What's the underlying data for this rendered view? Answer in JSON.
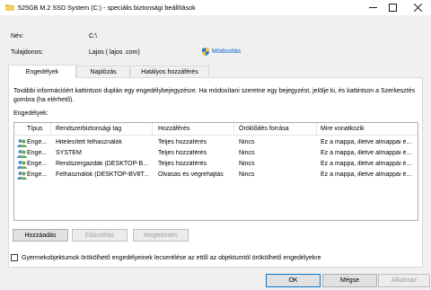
{
  "window": {
    "title": "525GB M.2 SSD System (C:) - speciális biztonsági beállítások"
  },
  "fields": {
    "name_label": "Név:",
    "name_value": "C:\\",
    "owner_label": "Tulajdonos:",
    "owner_value": "Lajos (     lajos              .com)",
    "modify_link": "Módosítás"
  },
  "tabs": [
    {
      "label": "Engedélyek",
      "active": true
    },
    {
      "label": "Naplózás",
      "active": false
    },
    {
      "label": "Hatályos hozzáférés",
      "active": false
    }
  ],
  "info_text": "További információért kattintson duplán egy engedélybejegyzésre. Ha módosítani szeretne egy bejegyzést, jelölje ki, és kattintson a Szerkesztés gombra (ha elérhető).",
  "permissions_label": "Engedélyek:",
  "table": {
    "columns": [
      "Típus",
      "Rendszerbiztonsági tag",
      "Hozzáférés",
      "Öröklődés forrása",
      "Mire vonatkozik"
    ],
    "rows": [
      [
        "Enge...",
        "Hitelesített felhasználók",
        "Teljes hozzáférés",
        "Nincs",
        "Ez a mappa, illetve almappái é..."
      ],
      [
        "Enge...",
        "SYSTEM",
        "Teljes hozzáférés",
        "Nincs",
        "Ez a mappa, illetve almappái é..."
      ],
      [
        "Enge...",
        "Rendszergazdák (DESKTOP-B...",
        "Teljes hozzáférés",
        "Nincs",
        "Ez a mappa, illetve almappái é..."
      ],
      [
        "Enge...",
        "Felhasználók (DESKTOP-BV8T...",
        "Olvasás és végrehajtás",
        "Nincs",
        "Ez a mappa, illetve almappái é..."
      ]
    ]
  },
  "buttons": {
    "add": "Hozzáadás",
    "remove": "Eltávolítás",
    "view": "Megtekintés",
    "ok": "OK",
    "cancel": "Mégse",
    "apply": "Alkalmaz"
  },
  "inherit_checkbox": {
    "label": "Gyermekobjektumok örökölhető engedélyeinek lecserélése az ettől az objektumtól örökölhető engedélyekre",
    "checked": false
  },
  "colors": {
    "link": "#0066cc",
    "accent": "#0078d7",
    "folder": "#e8b84a"
  }
}
